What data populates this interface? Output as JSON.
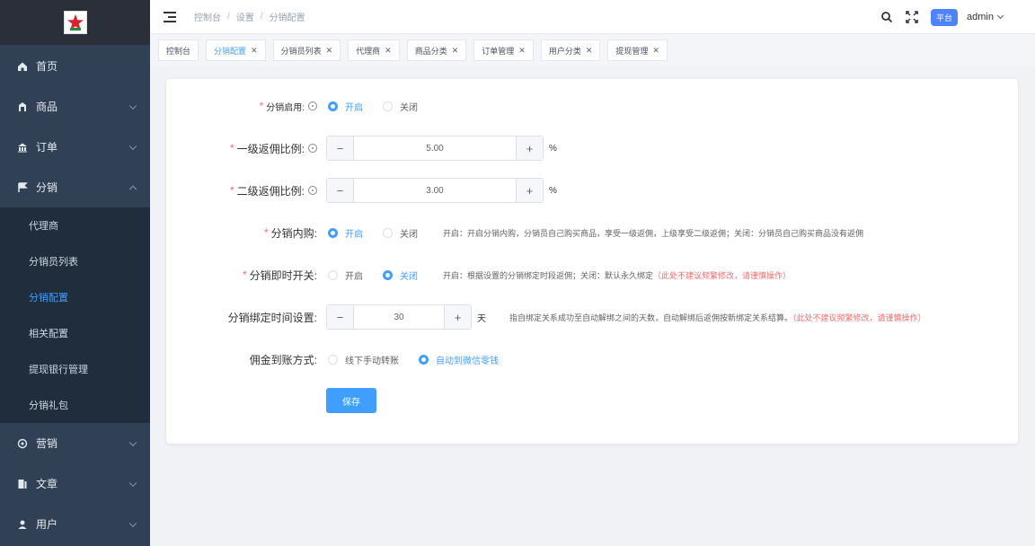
{
  "sidebar": {
    "menu": [
      {
        "label": "首页",
        "icon": "home-icon"
      },
      {
        "label": "商品",
        "icon": "goods-icon"
      },
      {
        "label": "订单",
        "icon": "order-icon"
      },
      {
        "label": "分销",
        "icon": "distribution-icon"
      }
    ],
    "submenu": [
      {
        "label": "代理商"
      },
      {
        "label": "分销员列表"
      },
      {
        "label": "分销配置"
      },
      {
        "label": "相关配置"
      },
      {
        "label": "提现银行管理"
      },
      {
        "label": "分销礼包"
      }
    ],
    "menu_bottom": [
      {
        "label": "营销",
        "icon": "marketing-icon"
      },
      {
        "label": "文章",
        "icon": "article-icon"
      },
      {
        "label": "用户",
        "icon": "user-icon"
      }
    ]
  },
  "header": {
    "breadcrumb": [
      "控制台",
      "设置",
      "分销配置"
    ],
    "platform_badge": "平台",
    "admin_name": "admin"
  },
  "tags": [
    {
      "label": "控制台",
      "closable": false
    },
    {
      "label": "分销配置",
      "closable": true,
      "active": true
    },
    {
      "label": "分销员列表",
      "closable": true
    },
    {
      "label": "代理商",
      "closable": true
    },
    {
      "label": "商品分类",
      "closable": true
    },
    {
      "label": "订单管理",
      "closable": true
    },
    {
      "label": "用户分类",
      "closable": true
    },
    {
      "label": "提现管理",
      "closable": true
    }
  ],
  "form": {
    "enable": {
      "label": "分销启用:",
      "options": [
        "开启",
        "关闭"
      ],
      "selected": "开启"
    },
    "level1": {
      "label": "一级返佣比例:",
      "value": "5.00",
      "unit": "%"
    },
    "level2": {
      "label": "二级返佣比例:",
      "value": "3.00",
      "unit": "%"
    },
    "self_purchase": {
      "label": "分销内购:",
      "options": [
        "开启",
        "关闭"
      ],
      "selected": "开启",
      "hint": "开启：开启分销内购，分销员自己购买商品，享受一级返佣，上级享受二级返佣；关闭：分销员自己购买商品没有返佣"
    },
    "instant_bind": {
      "label": "分销即时开关:",
      "options": [
        "开启",
        "关闭"
      ],
      "selected": "关闭",
      "hint": "开启：根据设置的分销绑定时段返佣；关闭：默认永久绑定",
      "warn": "（此处不建议频繁修改，请谨慎操作）"
    },
    "bind_time": {
      "label": "分销绑定时间设置:",
      "value": "30",
      "unit": "天",
      "hint": "指自绑定关系成功至自动解绑之间的天数，自动解绑后返佣按新绑定关系结算。",
      "warn": "（此处不建议频繁修改，请谨慎操作）"
    },
    "payout": {
      "label": "佣金到账方式:",
      "options": [
        "线下手动转账",
        "自动到微信零钱"
      ],
      "selected": "自动到微信零钱"
    },
    "save_label": "保存"
  }
}
